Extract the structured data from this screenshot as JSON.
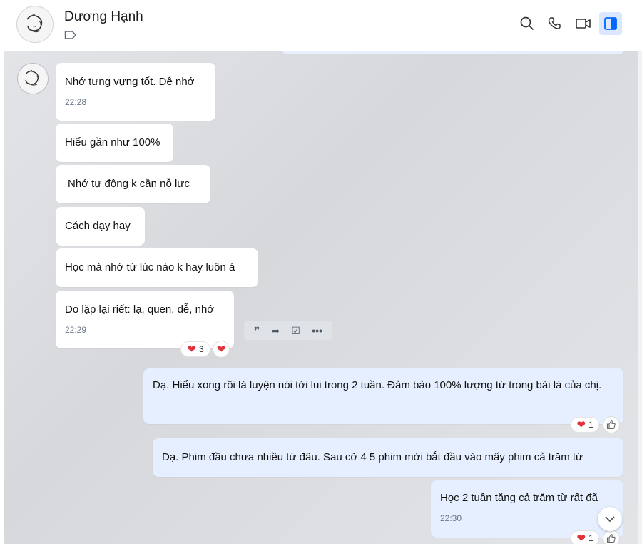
{
  "header": {
    "contact_name": "Dương Hạnh",
    "icons": [
      "search-icon",
      "phone-icon",
      "video-call-icon",
      "sidebar-toggle-icon"
    ]
  },
  "messages": [
    {
      "text": "Nhớ tưng vựng tốt. Dễ nhớ",
      "time": "22:28"
    },
    {
      "text": "Hiểu gần như 100%"
    },
    {
      "text": "Nhớ tự động k cần nỗ lực"
    },
    {
      "text": "Cách dạy hay"
    },
    {
      "text": "Học mà nhớ từ lúc nào k hay luôn á"
    },
    {
      "text": "Do lặp lại riết: lạ, quen, dễ, nhớ",
      "time": "22:29",
      "reaction_count": "3"
    }
  ],
  "my_messages": [
    {
      "text": "Dạ. Hiểu xong rồi là luyện nói tới lui trong 2 tuần. Đảm bảo 100% lượng từ trong bài là của chị.",
      "reaction_count": "1"
    },
    {
      "text": "Dạ. Phim đầu chưa nhiều từ đâu. Sau cỡ 4 5 phim mới bắt đầu vào mấy phim cả trăm từ"
    },
    {
      "text": "Học 2 tuần tăng cả trăm từ rất đã",
      "time": "22:30",
      "reaction_count": "1"
    }
  ],
  "hover_actions": [
    "quote-icon",
    "forward-icon",
    "task-icon",
    "more-icon"
  ],
  "colors": {
    "accent": "#0068ff",
    "my_bubble": "#e5efff",
    "heart": "#e0323c"
  }
}
